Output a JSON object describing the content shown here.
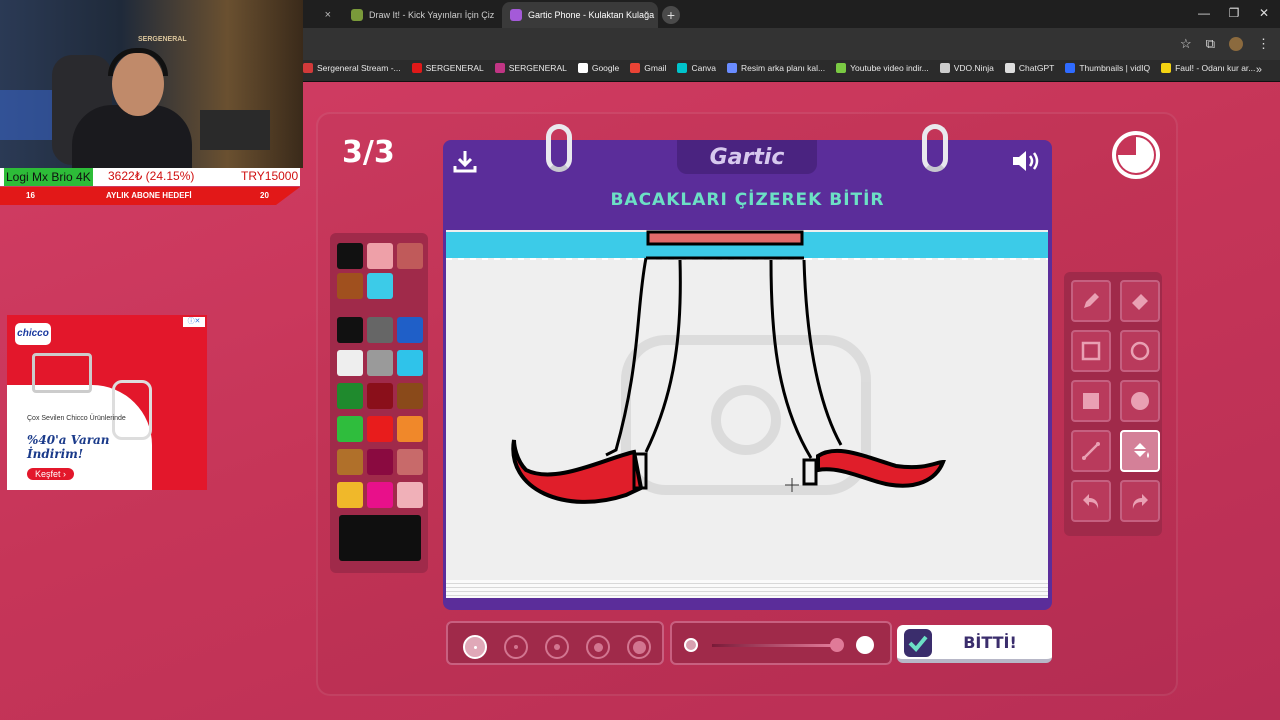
{
  "browser": {
    "tabs": [
      {
        "label": ""
      },
      {
        "label": "Draw It! - Kick Yayınları İçin Çiz"
      },
      {
        "label": "Gartic Phone - Kulaktan Kulağa"
      }
    ],
    "bookmarks": [
      {
        "label": "Sergeneral Stream -...",
        "color": "#d23a3a"
      },
      {
        "label": "SERGENERAL",
        "color": "#e01919"
      },
      {
        "label": "SERGENERAL",
        "color": "#c13584"
      },
      {
        "label": "Google",
        "color": "#ffffff"
      },
      {
        "label": "Gmail",
        "color": "#ea4335"
      },
      {
        "label": "Canva",
        "color": "#00c4cc"
      },
      {
        "label": "Resim arka planı kal...",
        "color": "#6a8cff"
      },
      {
        "label": "Youtube video indir...",
        "color": "#7ac943"
      },
      {
        "label": "VDO.Ninja",
        "color": "#cccccc"
      },
      {
        "label": "ChatGPT",
        "color": "#dddddd"
      },
      {
        "label": "Thumbnails | vidIQ",
        "color": "#2f6bff"
      },
      {
        "label": "Faul! - Odanı kur ar...",
        "color": "#f3d312"
      }
    ],
    "more": "»"
  },
  "game": {
    "round": "3/3",
    "logo": "Gartic",
    "instruction": "BACAKLARI ÇİZEREK BİTİR",
    "done_label": "BİTTİ!",
    "palette_top": [
      "#111111",
      "#eea0a8",
      "#c05a5a",
      "#a0501e",
      "#3ccbe8"
    ],
    "palette": [
      "#111111",
      "#666666",
      "#1f5fc8",
      "#eeeeee",
      "#9a9a9a",
      "#2fc3ea",
      "#1f8a2d",
      "#8a0f1a",
      "#8a4a1a",
      "#2fbd3d",
      "#e81c1c",
      "#f0882a",
      "#b0702a",
      "#8a0a40",
      "#c86a6a",
      "#f0b82a",
      "#e8108a",
      "#f0b0b8"
    ],
    "current_color": "#0f0f0f",
    "tools": [
      "pencil-icon",
      "eraser-icon",
      "rect-outline-icon",
      "circle-outline-icon",
      "rect-filled-icon",
      "circle-filled-icon",
      "line-icon",
      "fill-bucket-icon",
      "undo-icon",
      "redo-icon"
    ],
    "selected_tool": "fill-bucket-icon",
    "brush_sizes": 5,
    "selected_brush": 0
  },
  "stream": {
    "camera_label": "Logi Mx Brio 4K",
    "donation": "3622₺ (24.15%)",
    "target": "TRY15000",
    "goal_from": "16",
    "goal_label": "AYLIK ABONE HEDEFİ",
    "goal_to": "20",
    "cam_sign": "SERGENERAL"
  },
  "ad": {
    "brand": "chicco",
    "tagline": "Çox Sevilen Chicco Ürünlerinde",
    "headline": "%40'a Varan İndirim!",
    "cta": "Keşfet ›"
  }
}
